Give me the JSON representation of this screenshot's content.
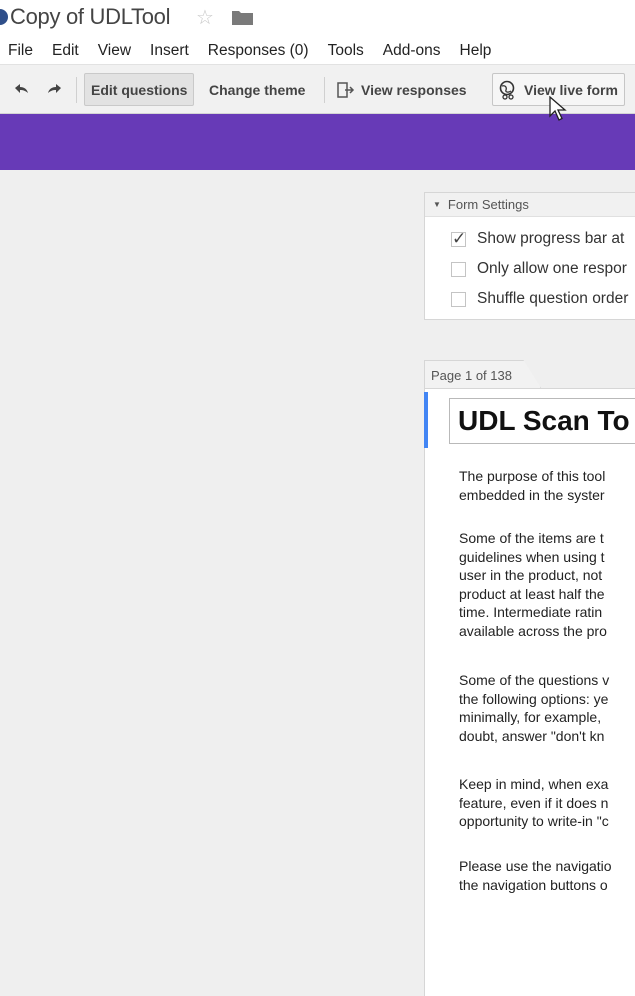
{
  "window": {
    "doc_title": "Copy of UDLTool"
  },
  "menu": [
    "File",
    "Edit",
    "View",
    "Insert",
    "Responses (0)",
    "Tools",
    "Add-ons",
    "Help"
  ],
  "toolbar": {
    "edit_questions": "Edit questions",
    "change_theme": "Change theme",
    "view_responses": "View responses",
    "view_live_form": "View live form"
  },
  "theme_color": "#673ab7",
  "form_settings": {
    "header": "Form Settings",
    "options": [
      {
        "label": "Show progress bar at",
        "checked": true
      },
      {
        "label": "Only allow one respor",
        "checked": false
      },
      {
        "label": "Shuffle question order",
        "checked": false
      }
    ]
  },
  "page": {
    "indicator": "Page 1 of 138",
    "title": "UDL Scan To",
    "paragraphs": [
      [
        "The purpose of this tool",
        "embedded in the syster"
      ],
      [
        "Some of the items are t",
        "guidelines when using t",
        "user in the product, not",
        "product at least half the",
        "time.  Intermediate ratin",
        "available across the pro"
      ],
      [
        "Some of the questions v",
        "the following options: ye",
        "minimally, for example,",
        "doubt, answer \"don't kn"
      ],
      [
        "Keep in mind, when exa",
        "feature, even if it does n",
        "opportunity to write-in \"c"
      ],
      [
        "Please use the navigatio",
        "the navigation buttons o"
      ]
    ]
  }
}
